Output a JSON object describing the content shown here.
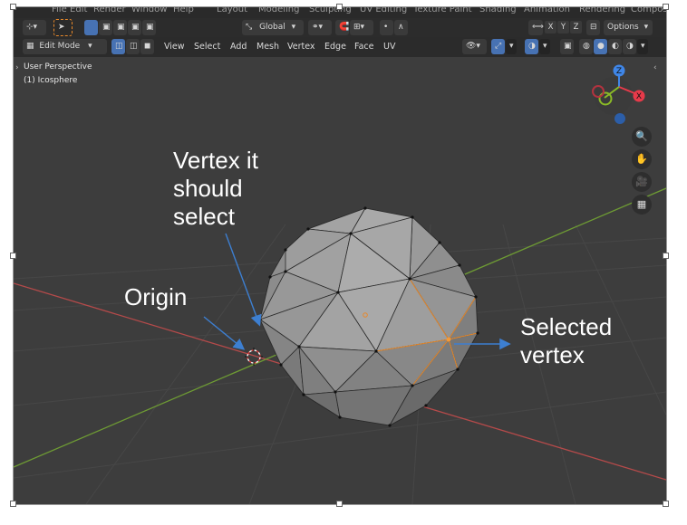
{
  "workspace_tabs": [
    "File",
    "Edit",
    "Render",
    "Window",
    "Help",
    "Layout",
    "Modeling",
    "Sculpting",
    "UV Editing",
    "Texture Paint",
    "Shading",
    "Animation",
    "Rendering",
    "Compositing"
  ],
  "header": {
    "transform_orientation": "Global",
    "axis_x": "X",
    "axis_y": "Y",
    "axis_z": "Z",
    "options_label": "Options"
  },
  "toolbar": {
    "mode_label": "Edit Mode",
    "menu": [
      "View",
      "Select",
      "Add",
      "Mesh",
      "Vertex",
      "Edge",
      "Face",
      "UV"
    ]
  },
  "viewport": {
    "perspective": "User Perspective",
    "object": "(1) Icosphere",
    "gizmo": {
      "x": "X",
      "y": "Y",
      "z": "Z"
    }
  },
  "annotations": {
    "top": "Vertex it\nshould\nselect",
    "origin": "Origin",
    "selected": "Selected\nvertex"
  },
  "colors": {
    "viewport_bg": "#3d3d3d",
    "x_axis": "#b54a4a",
    "y_axis": "#6e9b34",
    "selected": "#e8892a",
    "gizmo_x": "#e83a4a",
    "gizmo_y": "#8bbb26",
    "gizmo_z": "#3f86e8"
  }
}
